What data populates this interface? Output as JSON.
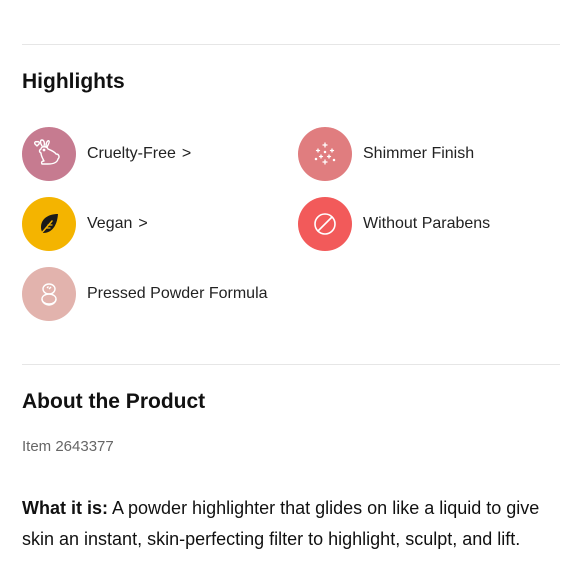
{
  "highlights": {
    "title": "Highlights",
    "items": [
      {
        "label": "Cruelty-Free",
        "chevron": ">",
        "icon": "bunny-icon",
        "color": "#c67b90"
      },
      {
        "label": "Shimmer Finish",
        "icon": "sparkle-icon",
        "color": "#e07d7f"
      },
      {
        "label": "Vegan",
        "chevron": ">",
        "icon": "leaf-icon",
        "color": "#f4b400"
      },
      {
        "label": "Without Parabens",
        "icon": "no-symbol-icon",
        "color": "#f25a5a"
      },
      {
        "label": "Pressed Powder Formula",
        "icon": "compact-icon",
        "color": "#e2b3ad"
      }
    ]
  },
  "about": {
    "title": "About the Product",
    "item_number": "Item 2643377",
    "what_it_is_label": "What it is:",
    "what_it_is_text": " A powder highlighter that glides on like a liquid to give skin an instant, skin-perfecting filter to highlight, sculpt, and lift."
  }
}
